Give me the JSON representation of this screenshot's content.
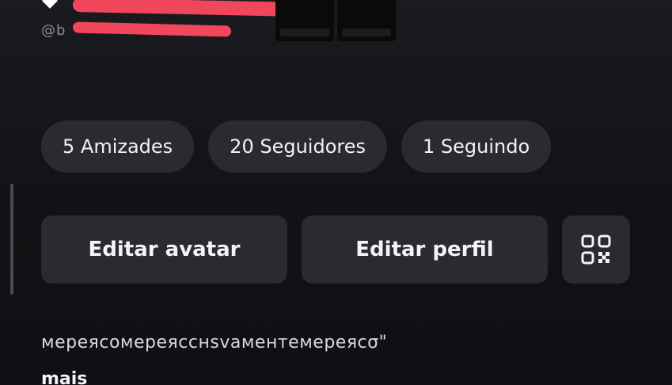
{
  "profile": {
    "handle": "@b"
  },
  "stats": [
    {
      "label": "5 Amizades"
    },
    {
      "label": "20 Seguidores"
    },
    {
      "label": "1 Seguindo"
    }
  ],
  "actions": {
    "edit_avatar": "Editar avatar",
    "edit_profile": "Editar perfil",
    "qr_icon": "qr-code-icon"
  },
  "bio": {
    "text": "мереясомереясснѕvaмeнтемереясσ\"",
    "more_label": "mais"
  },
  "colors": {
    "background": "#111215",
    "pill": "#2a2b31",
    "redaction": "#f0475a"
  }
}
